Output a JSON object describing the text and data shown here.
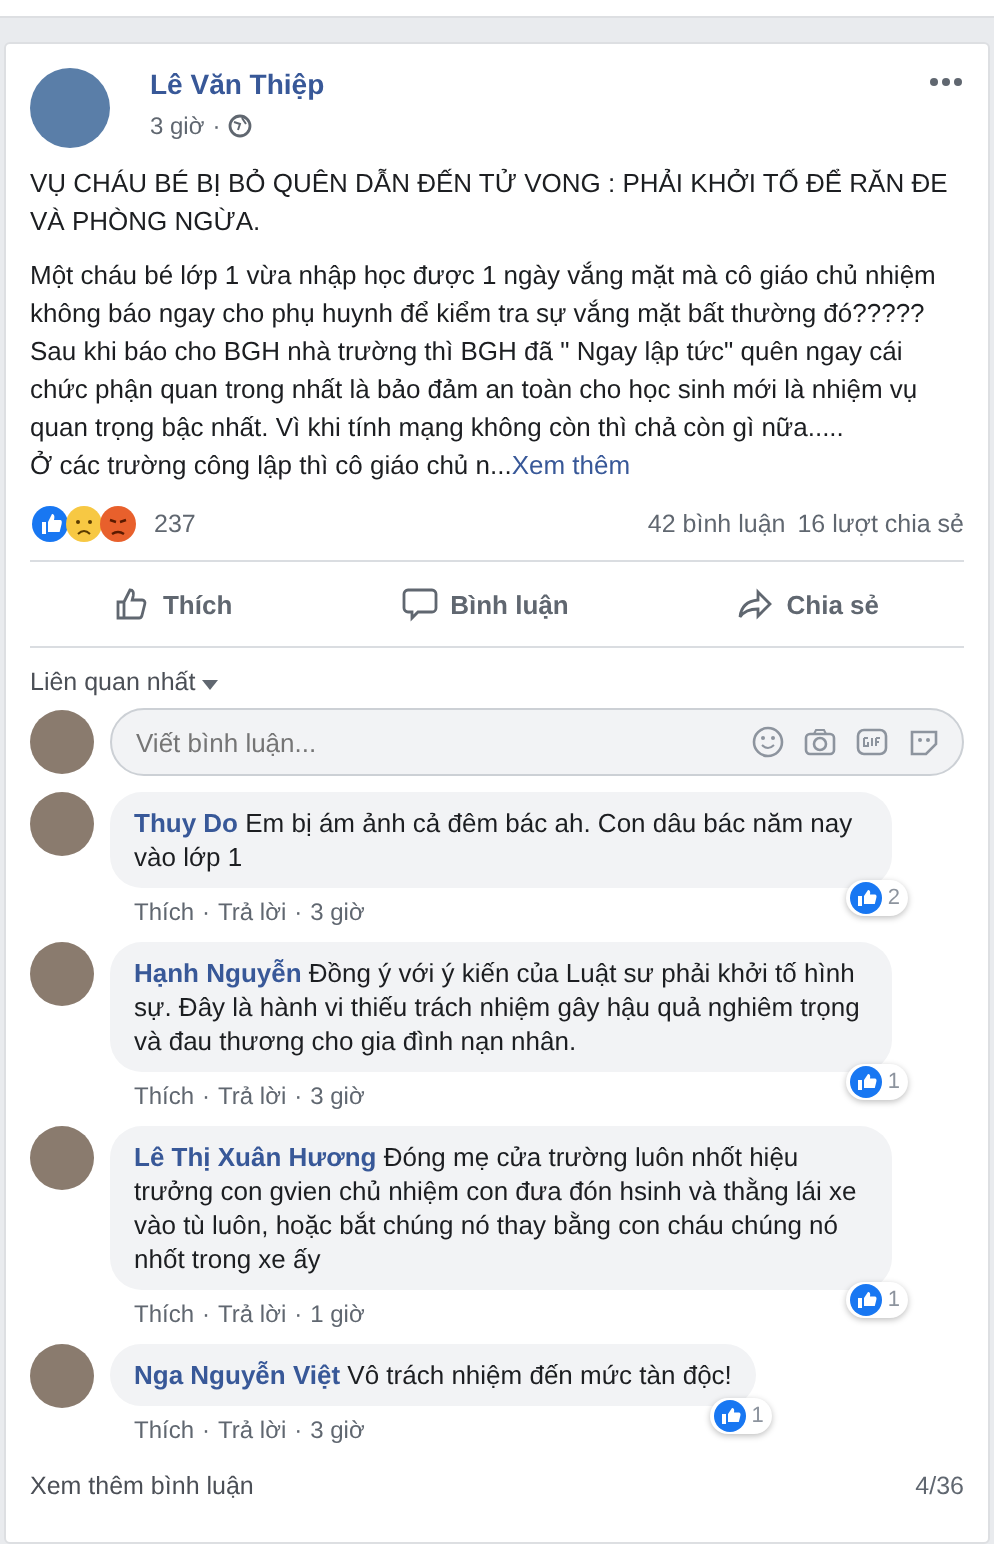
{
  "post": {
    "author": "Lê Văn Thiệp",
    "time": "3 giờ",
    "paragraphs": [
      "VỤ CHÁU BÉ BỊ BỎ QUÊN DẪN ĐẾN TỬ VONG : PHẢI KHỞI TỐ ĐỂ RĂN ĐE VÀ PHÒNG NGỪA.",
      "Một cháu bé lớp 1 vừa nhập học được 1 ngày vắng mặt mà cô giáo chủ nhiệm không báo ngay cho phụ huynh để kiểm tra sự vắng mặt bất thường đó?????\nSau khi báo cho BGH nhà trường thì BGH đã \" Ngay lập tức\" quên ngay cái chức phận quan trong nhất là bảo đảm an toàn cho học sinh mới là nhiệm vụ quan trọng bậc nhất. Vì khi tính mạng không còn thì chả còn gì nữa.....\nỞ các trường công lập thì cô giáo chủ n..."
    ],
    "see_more": "Xem thêm"
  },
  "reactions": {
    "count": "237",
    "comments": "42 bình luận",
    "shares": "16 lượt chia sẻ"
  },
  "actions": [
    {
      "kind": "like",
      "label": "Thích"
    },
    {
      "kind": "comment",
      "label": "Bình luận"
    },
    {
      "kind": "share",
      "label": "Chia sẻ"
    }
  ],
  "sort": "Liên quan nhất",
  "composer": {
    "placeholder": "Viết bình luận..."
  },
  "comments": [
    {
      "author": "Thuy Do",
      "text": "Em bị ám ảnh cả đêm bác ah. Con dâu bác năm nay vào lớp 1",
      "likes": "2",
      "like": "Thích",
      "reply": "Trả lời",
      "time": "3 giờ"
    },
    {
      "author": "Hạnh Nguyễn",
      "text": "Đồng ý với ý kiến của Luật sư phải khởi tố hình sự. Đây là hành vi thiếu trách nhiệm gây hậu quả nghiêm trọng và đau thương cho gia đình nạn nhân.",
      "likes": "1",
      "like": "Thích",
      "reply": "Trả lời",
      "time": "3 giờ"
    },
    {
      "author": "Lê Thị Xuân Hương",
      "text": "Đóng mẹ cửa trường luôn nhốt hiệu trưởng con gvien chủ nhiệm con đưa đón hsinh và thằng lái xe vào tù luôn, hoặc bắt chúng nó thay bằng con cháu chúng nó nhốt trong xe ấy",
      "likes": "1",
      "like": "Thích",
      "reply": "Trả lời",
      "time": "1 giờ"
    },
    {
      "author": "Nga Nguyễn Việt",
      "text": "Vô trách nhiệm đến mức tàn độc!",
      "likes": "1",
      "like": "Thích",
      "reply": "Trả lời",
      "time": "3 giờ"
    }
  ],
  "more_comments": "Xem thêm bình luận",
  "pager": "4/36",
  "separator": "·"
}
